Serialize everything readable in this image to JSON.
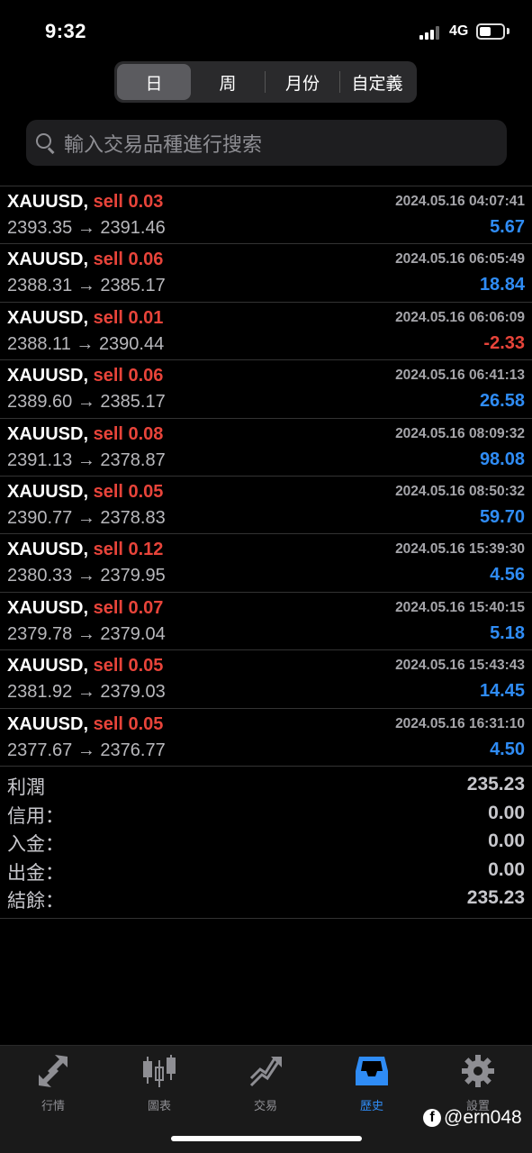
{
  "status_bar": {
    "time": "9:32",
    "network": "4G"
  },
  "period_tabs": [
    {
      "label": "日",
      "active": true
    },
    {
      "label": "周",
      "active": false
    },
    {
      "label": "月份",
      "active": false
    },
    {
      "label": "自定義",
      "active": false
    }
  ],
  "search": {
    "placeholder": "輸入交易品種進行搜索"
  },
  "trades": [
    {
      "symbol": "XAUUSD,",
      "side": "sell 0.03",
      "time": "2024.05.16 04:07:41",
      "open": "2393.35",
      "arrow": "→",
      "close": "2391.46",
      "profit": "5.67"
    },
    {
      "symbol": "XAUUSD,",
      "side": "sell 0.06",
      "time": "2024.05.16 06:05:49",
      "open": "2388.31",
      "arrow": "→",
      "close": "2385.17",
      "profit": "18.84"
    },
    {
      "symbol": "XAUUSD,",
      "side": "sell 0.01",
      "time": "2024.05.16 06:06:09",
      "open": "2388.11",
      "arrow": "→",
      "close": "2390.44",
      "profit": "-2.33"
    },
    {
      "symbol": "XAUUSD,",
      "side": "sell 0.06",
      "time": "2024.05.16 06:41:13",
      "open": "2389.60",
      "arrow": "→",
      "close": "2385.17",
      "profit": "26.58"
    },
    {
      "symbol": "XAUUSD,",
      "side": "sell 0.08",
      "time": "2024.05.16 08:09:32",
      "open": "2391.13",
      "arrow": "→",
      "close": "2378.87",
      "profit": "98.08"
    },
    {
      "symbol": "XAUUSD,",
      "side": "sell 0.05",
      "time": "2024.05.16 08:50:32",
      "open": "2390.77",
      "arrow": "→",
      "close": "2378.83",
      "profit": "59.70"
    },
    {
      "symbol": "XAUUSD,",
      "side": "sell 0.12",
      "time": "2024.05.16 15:39:30",
      "open": "2380.33",
      "arrow": "→",
      "close": "2379.95",
      "profit": "4.56"
    },
    {
      "symbol": "XAUUSD,",
      "side": "sell 0.07",
      "time": "2024.05.16 15:40:15",
      "open": "2379.78",
      "arrow": "→",
      "close": "2379.04",
      "profit": "5.18"
    },
    {
      "symbol": "XAUUSD,",
      "side": "sell 0.05",
      "time": "2024.05.16 15:43:43",
      "open": "2381.92",
      "arrow": "→",
      "close": "2379.03",
      "profit": "14.45"
    },
    {
      "symbol": "XAUUSD,",
      "side": "sell 0.05",
      "time": "2024.05.16 16:31:10",
      "open": "2377.67",
      "arrow": "→",
      "close": "2376.77",
      "profit": "4.50"
    }
  ],
  "summary": [
    {
      "label": "利潤",
      "value": "235.23"
    },
    {
      "label": "信用：",
      "value": "0.00"
    },
    {
      "label": "入金：",
      "value": "0.00"
    },
    {
      "label": "出金：",
      "value": "0.00"
    },
    {
      "label": "結餘：",
      "value": "235.23"
    }
  ],
  "tabbar": [
    {
      "label": "行情",
      "icon": "arrows-icon",
      "active": false
    },
    {
      "label": "圖表",
      "icon": "candlestick-icon",
      "active": false
    },
    {
      "label": "交易",
      "icon": "trend-icon",
      "active": false
    },
    {
      "label": "歷史",
      "icon": "inbox-icon",
      "active": true
    },
    {
      "label": "設置",
      "icon": "gear-icon",
      "active": false
    }
  ],
  "colors": {
    "profit_positive": "#2f8cf5",
    "profit_negative": "#e8443a",
    "sell": "#e8443a",
    "active_tab": "#2f8cf5"
  },
  "watermark": "@ern048"
}
